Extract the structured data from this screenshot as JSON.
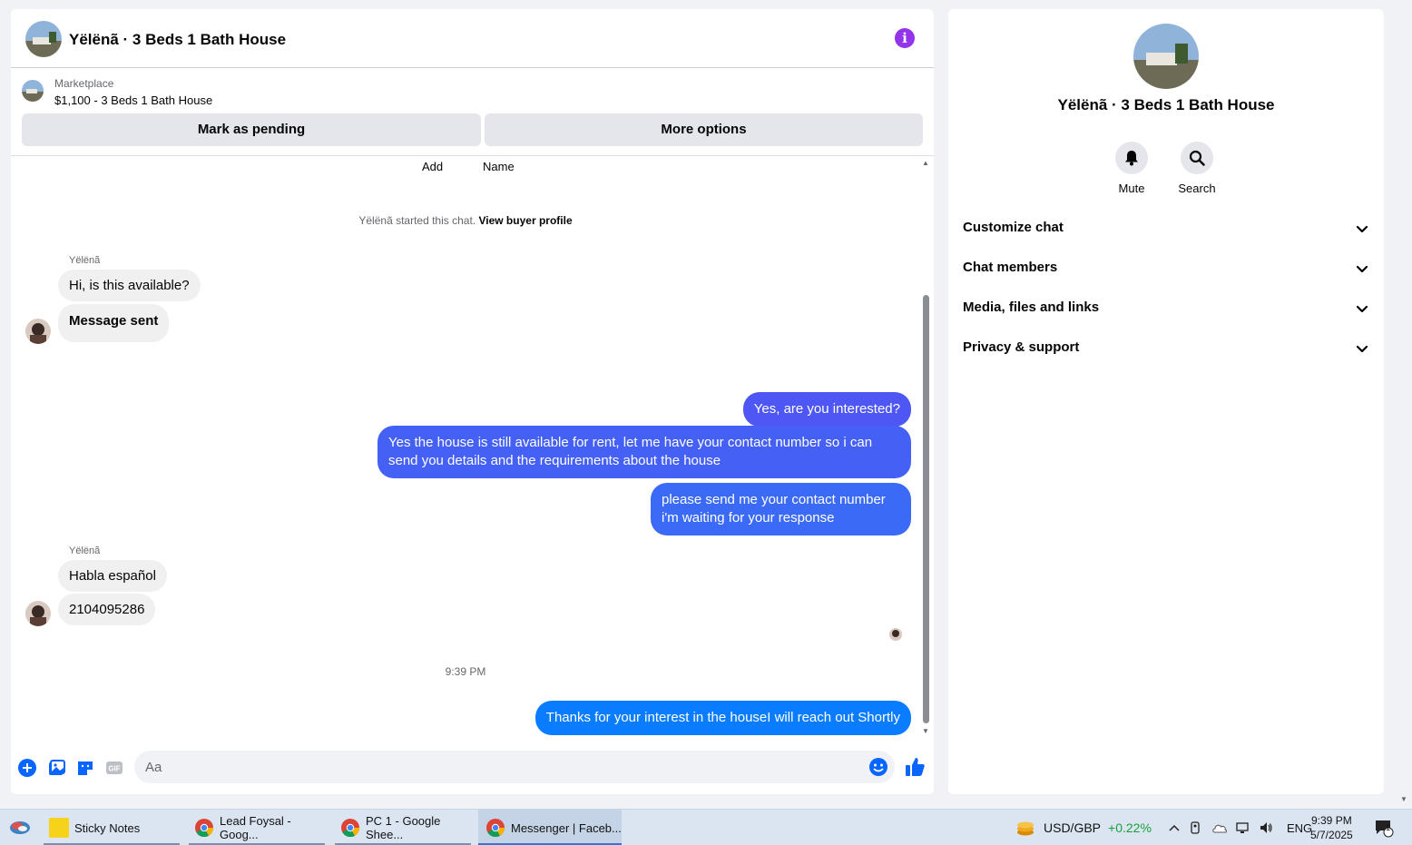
{
  "chat": {
    "title": "Yëlënã · 3 Beds 1 Bath House",
    "listing": {
      "source": "Marketplace",
      "price_title": "$1,100 - 3 Beds 1 Bath House",
      "pending_label": "Mark as pending",
      "more_label": "More options"
    },
    "tabs": {
      "add": "Add",
      "name": "Name"
    },
    "started": "Yëlënã started this chat.",
    "buyer_profile": "View buyer profile",
    "sender_name": "Yëlënã",
    "incoming_1": [
      "Hi, is this available?",
      "Message sent"
    ],
    "outgoing_1": [
      "Yes, are you interested?",
      "Yes the house is still available for rent, let me have your contact number so i can send you details and the requirements about the house",
      "please send me your contact number i'm waiting for your response"
    ],
    "incoming_2": [
      "Habla español",
      "2104095286"
    ],
    "timestamp": "9:39 PM",
    "outgoing_2": "Thanks for your interest in the houseI will reach out Shortly",
    "composer_placeholder": "Aa"
  },
  "info_panel": {
    "title": "Yëlënã · 3 Beds 1 Bath House",
    "actions": [
      {
        "label": "Mute",
        "icon": "bell-icon"
      },
      {
        "label": "Search",
        "icon": "search-icon"
      }
    ],
    "sections": [
      "Customize chat",
      "Chat members",
      "Media, files and links",
      "Privacy & support"
    ]
  },
  "taskbar": {
    "apps": [
      {
        "label": "Sticky Notes"
      },
      {
        "label": "Lead Foysal - Goog..."
      },
      {
        "label": "PC 1 - Google Shee..."
      },
      {
        "label": "Messenger | Faceb..."
      }
    ],
    "ticker": "USD/GBP",
    "ticker_change": "+0.22%",
    "lang": "ENG",
    "time": "9:39 PM",
    "date": "5/7/2025",
    "notif_count": "1"
  },
  "colors": {
    "accent": "#0a7cff",
    "info": "#9333ea",
    "ticker_up": "#1a9f3a"
  }
}
